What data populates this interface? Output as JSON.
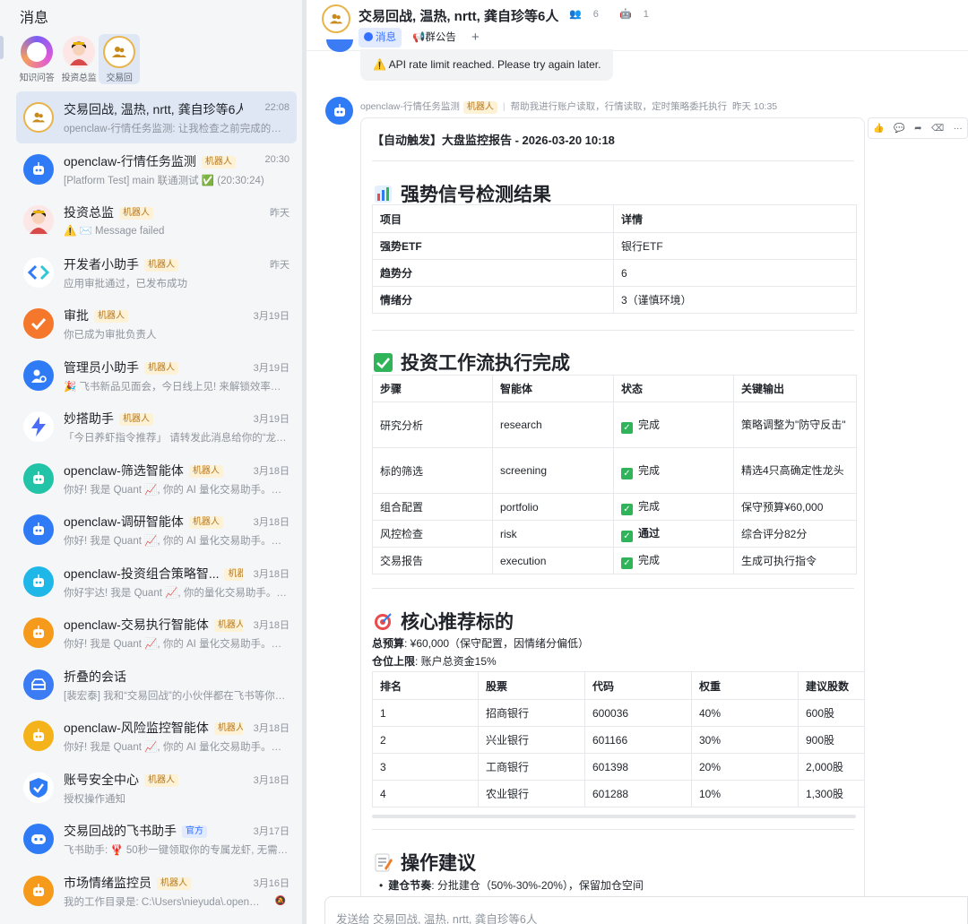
{
  "sidebar": {
    "title": "消息",
    "pinned": [
      {
        "label": "知识问答"
      },
      {
        "label": "投资总监"
      },
      {
        "label": "交易回"
      }
    ],
    "chats": [
      {
        "name": "交易回战, 温热, nrtt, 龚自珍等6人",
        "tag": "",
        "time": "22:08",
        "preview": "openclaw-行情任务监测: 让我检查之前完成的子…"
      },
      {
        "name": "openclaw-行情任务监测",
        "tag": "机器人",
        "time": "20:30",
        "preview": "[Platform Test] main 联通测试 ✅ (20:30:24)"
      },
      {
        "name": "投资总监",
        "tag": "机器人",
        "time": "昨天",
        "preview": "⚠️ ✉️ Message failed"
      },
      {
        "name": "开发者小助手",
        "tag": "机器人",
        "time": "昨天",
        "preview": "应用审批通过，已发布成功"
      },
      {
        "name": "审批",
        "tag": "机器人",
        "time": "3月19日",
        "preview": "你已成为审批负责人"
      },
      {
        "name": "管理员小助手",
        "tag": "机器人",
        "time": "3月19日",
        "preview": "🎉 飞书新品见面会，今日线上见! 来解锁效率新…"
      },
      {
        "name": "妙搭助手",
        "tag": "机器人",
        "time": "3月19日",
        "preview": "「今日养虾指令推荐」 请转发此消息给你的“龙虾…"
      },
      {
        "name": "openclaw-筛选智能体",
        "tag": "机器人",
        "time": "3月18日",
        "preview": "你好! 我是 Quant 📈, 你的 AI 量化交易助手。…"
      },
      {
        "name": "openclaw-调研智能体",
        "tag": "机器人",
        "time": "3月18日",
        "preview": "你好! 我是 Quant 📈, 你的 AI 量化交易助手。…"
      },
      {
        "name": "openclaw-投资组合策略智...",
        "tag": "机器人",
        "time": "3月18日",
        "preview": "你好宇达! 我是 Quant 📈, 你的量化交易助手。…"
      },
      {
        "name": "openclaw-交易执行智能体",
        "tag": "机器人",
        "time": "3月18日",
        "preview": "你好! 我是 Quant 📈, 你的 AI 量化交易助手。…"
      },
      {
        "name": "折叠的会话",
        "tag": "",
        "time": "",
        "preview": "[裴宏泰] 我和“交易回战”的小伙伴都在飞书等你…"
      },
      {
        "name": "openclaw-风险监控智能体",
        "tag": "机器人",
        "time": "3月18日",
        "preview": "你好! 我是 Quant 📈, 你的 AI 量化交易助手。…"
      },
      {
        "name": "账号安全中心",
        "tag": "机器人",
        "time": "3月18日",
        "preview": "授权操作通知"
      },
      {
        "name": "交易回战的飞书助手",
        "tag": "官方",
        "time": "3月17日",
        "preview": "飞书助手: 🦞 50秒一键领取你的专属龙虾, 无需…"
      },
      {
        "name": "市场情绪监控员",
        "tag": "机器人",
        "time": "3月16日",
        "preview": "我的工作目录是: C:\\Users\\nieyuda\\.open…"
      }
    ]
  },
  "header": {
    "title": "交易回战, 温热, nrtt, 龚自珍等6人",
    "members": "6",
    "bots": "1",
    "tabs": [
      "消息",
      "群公告"
    ],
    "add": "+"
  },
  "rate_limit": "API rate limit reached. Please try again later.",
  "message": {
    "sender": "openclaw-行情任务监测",
    "tag": "机器人",
    "note": "帮助我进行账户读取，行情读取，定时策略委托执行",
    "time": "昨天 10:35",
    "caption": "【自动触发】大盘监控报告 - 2026-03-20 10:18",
    "sec1_title": "强势信号检测结果",
    "sec1_header": [
      "项目",
      "详情"
    ],
    "sec1_rows": [
      [
        "强势ETF",
        "银行ETF"
      ],
      [
        "趋势分",
        "6"
      ],
      [
        "情绪分",
        "3（谨慎环境）"
      ]
    ],
    "sec2_title": "投资工作流执行完成",
    "sec2_header": [
      "步骤",
      "智能体",
      "状态",
      "关键输出"
    ],
    "sec2_rows": [
      [
        "研究分析",
        "research",
        "完成",
        "策略调整为\"防守反击\""
      ],
      [
        "标的筛选",
        "screening",
        "完成",
        "精选4只高确定性龙头"
      ],
      [
        "组合配置",
        "portfolio",
        "完成",
        "保守预算¥60,000"
      ],
      [
        "风控检查",
        "risk",
        "通过",
        "综合评分82分"
      ],
      [
        "交易报告",
        "execution",
        "完成",
        "生成可执行指令"
      ]
    ],
    "sec3_title": "核心推荐标的",
    "budget_label": "总预算",
    "budget_text": ": ¥60,000（保守配置，因情绪分偏低）",
    "cap_label": "仓位上限",
    "cap_text": ": 账户总资金15%",
    "sec3_header": [
      "排名",
      "股票",
      "代码",
      "权重",
      "建议股数"
    ],
    "sec3_rows": [
      [
        "1",
        "招商银行",
        "600036",
        "40%",
        "600股"
      ],
      [
        "2",
        "兴业银行",
        "601166",
        "30%",
        "900股"
      ],
      [
        "3",
        "工商银行",
        "601398",
        "20%",
        "2,000股"
      ],
      [
        "4",
        "农业银行",
        "601288",
        "10%",
        "1,300股"
      ]
    ],
    "sec4_title": "操作建议",
    "bullet_label": "建仓节奏",
    "bullet_text": ": 分批建仓（50%-30%-20%），保留加仓空间"
  },
  "input": {
    "placeholder": "发送给 交易回战, 温热, nrtt, 龚自珍等6人"
  },
  "colors": {
    "accent": "#3370ff",
    "active_item": "#dfe7f5",
    "bot_tag_bg": "#fdf1d6",
    "check": "#2fb45a"
  }
}
